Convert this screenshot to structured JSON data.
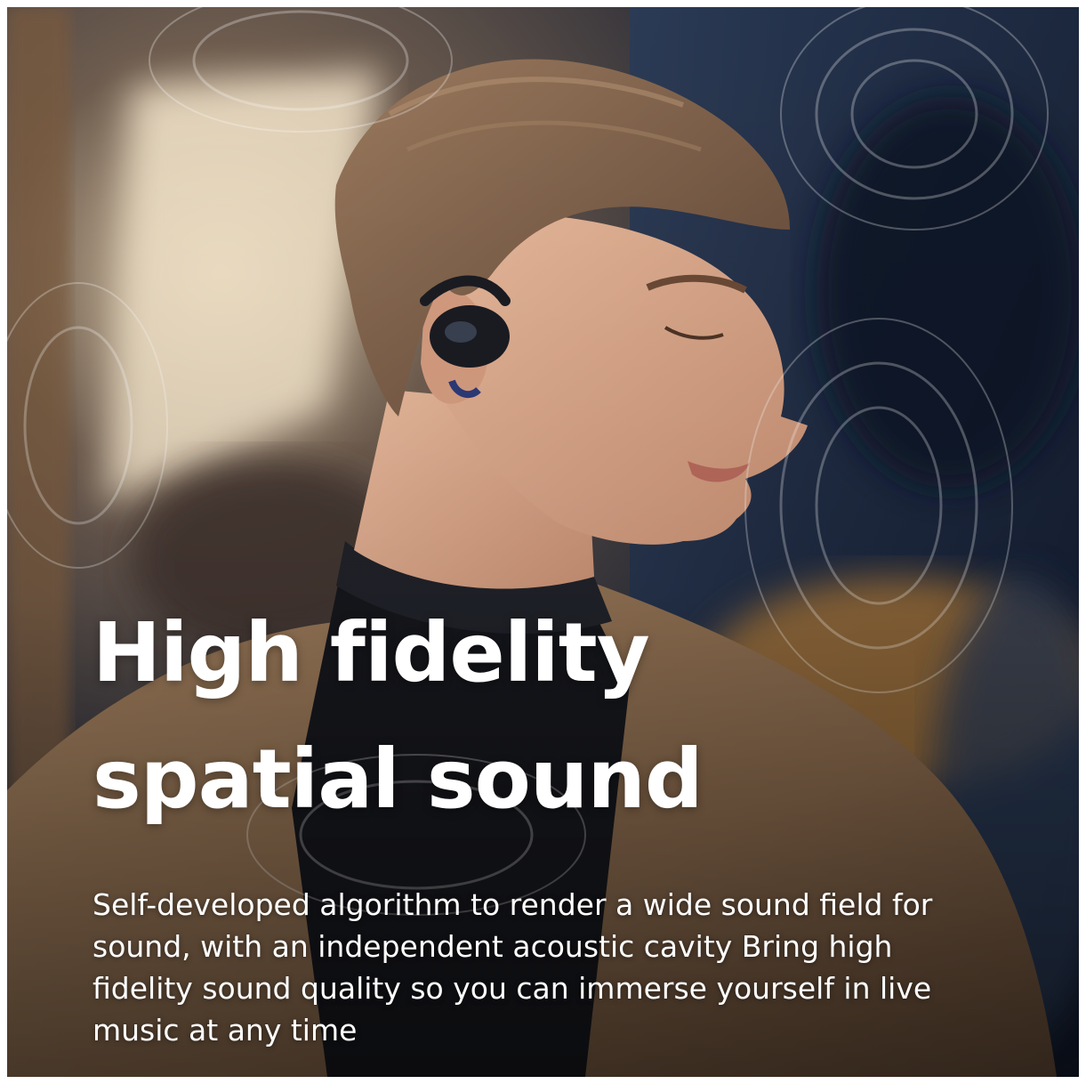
{
  "headline": {
    "line1": "High fidelity",
    "line2": "spatial sound"
  },
  "description": "Self-developed algorithm to render a wide sound field for sound, with an independent acoustic cavity Bring high fidelity sound quality so you can immerse yourself in live music at any time",
  "colors": {
    "text": "#ffffff",
    "background_dark": "#1c2230",
    "coat": "#8a6a4c",
    "skin": "#d9a98c",
    "hair": "#7d5f48",
    "earbud": "#1a1c22",
    "light_panel": "#e8d7bf"
  },
  "image": {
    "subject": "young man wearing open-ear earbud with translucent sound-wave rings"
  }
}
